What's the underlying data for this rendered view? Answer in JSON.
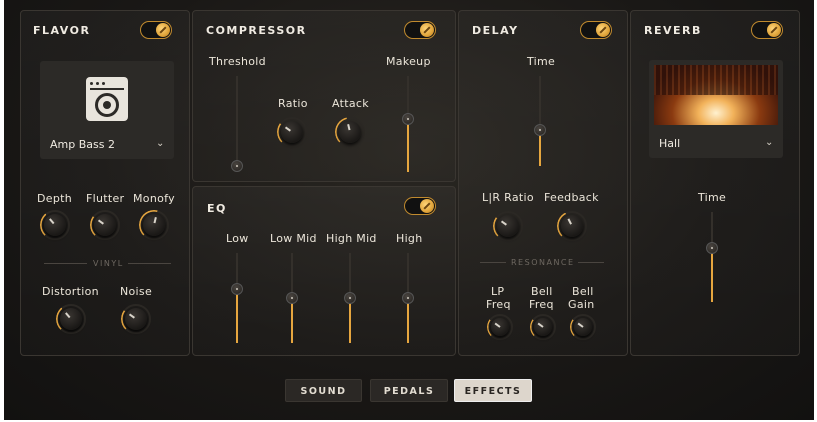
{
  "flavor": {
    "title": "FLAVOR",
    "toggle_on": true,
    "amp_select": "Amp Bass 2",
    "amp_icon": "amp-cabinet-icon",
    "knobs": [
      {
        "label": "Depth",
        "value": 0.35
      },
      {
        "label": "Flutter",
        "value": 0.3
      },
      {
        "label": "Monofy",
        "value": 0.55
      }
    ],
    "vinyl_label": "VINYL",
    "vinyl_knobs": [
      {
        "label": "Distortion",
        "value": 0.35
      },
      {
        "label": "Noise",
        "value": 0.3
      }
    ]
  },
  "compressor": {
    "title": "COMPRESSOR",
    "toggle_on": true,
    "threshold": {
      "label": "Threshold",
      "value": 0.0
    },
    "ratio": {
      "label": "Ratio",
      "value": 0.3
    },
    "attack": {
      "label": "Attack",
      "value": 0.45
    },
    "makeup": {
      "label": "Makeup",
      "value": 0.55
    }
  },
  "eq": {
    "title": "EQ",
    "toggle_on": true,
    "bands": [
      {
        "label": "Low",
        "value": 0.6
      },
      {
        "label": "Low Mid",
        "value": 0.5
      },
      {
        "label": "High Mid",
        "value": 0.5
      },
      {
        "label": "High",
        "value": 0.5
      }
    ]
  },
  "delay": {
    "title": "DELAY",
    "toggle_on": true,
    "time": {
      "label": "Time",
      "value": 0.4
    },
    "lr_ratio": {
      "label": "L|R Ratio",
      "value": 0.3
    },
    "feedback": {
      "label": "Feedback",
      "value": 0.4
    },
    "resonance_label": "RESONANCE",
    "res_knobs": [
      {
        "label": "LP Freq",
        "line1": "LP",
        "line2": "Freq",
        "value": 0.3
      },
      {
        "label": "Bell Freq",
        "line1": "Bell",
        "line2": "Freq",
        "value": 0.3
      },
      {
        "label": "Bell Gain",
        "line1": "Bell",
        "line2": "Gain",
        "value": 0.3
      }
    ]
  },
  "reverb": {
    "title": "REVERB",
    "toggle_on": true,
    "preset": "Hall",
    "time": {
      "label": "Time",
      "value": 0.6
    }
  },
  "tabs": [
    {
      "label": "SOUND",
      "active": false
    },
    {
      "label": "PEDALS",
      "active": false
    },
    {
      "label": "EFFECTS",
      "active": true
    }
  ],
  "colors": {
    "accent": "#e6a63f",
    "background": "#1a1816"
  }
}
